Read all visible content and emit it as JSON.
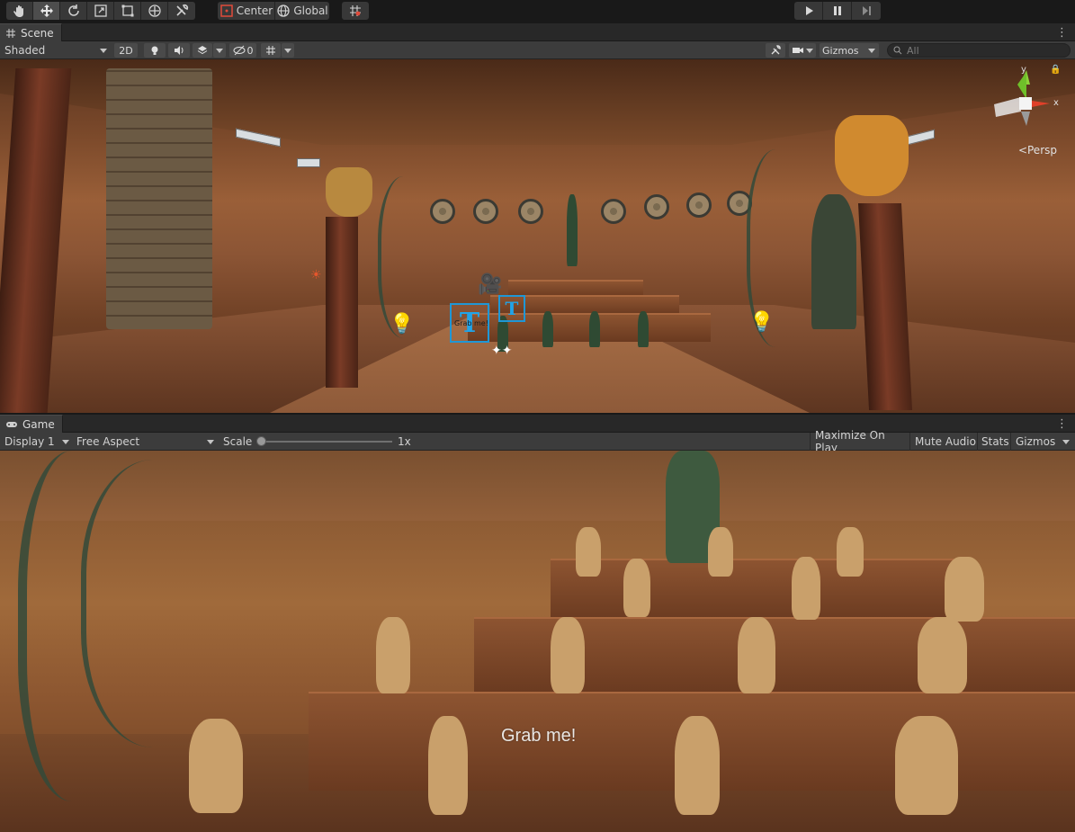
{
  "toolbar": {
    "tools": [
      "hand-tool",
      "move-tool",
      "rotate-tool",
      "scale-tool",
      "rect-tool",
      "transform-tool",
      "custom-tool"
    ],
    "active_tool": "move-tool",
    "pivot_label": "Center",
    "space_label": "Global",
    "play_controls": [
      "play",
      "pause",
      "step"
    ]
  },
  "scene": {
    "tab_label": "Scene",
    "shading_mode": "Shaded",
    "mode_2d_label": "2D",
    "hidden_count": "0",
    "gizmos_label": "Gizmos",
    "search_placeholder": "All",
    "orientation": {
      "y_label": "y",
      "x_label": "x",
      "persp_label": "Persp"
    },
    "text_gizmo_caption": "Grab me!"
  },
  "game": {
    "tab_label": "Game",
    "display": "Display 1",
    "aspect": "Free Aspect",
    "scale_label": "Scale",
    "scale_value": "1x",
    "maximize_label": "Maximize On Play",
    "mute_label": "Mute Audio",
    "stats_label": "Stats",
    "gizmos_label": "Gizmos",
    "world_text": "Grab me!"
  },
  "colors": {
    "editor_bg": "#191919",
    "panel_bar": "#3c3c3c",
    "tab_active": "#3c3c3c",
    "gizmo_blue": "#21a4e8",
    "light_yellow": "#f3c23a",
    "axis_x": "#e0402a",
    "axis_y": "#8ed13a"
  }
}
